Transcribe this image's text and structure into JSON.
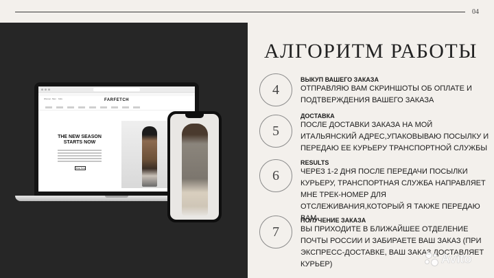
{
  "page_number": "04",
  "title": "АЛГОРИТМ РАБОТЫ",
  "mockup": {
    "site_logo": "FARFETCH",
    "nav_tabs": [
      "Women",
      "Men",
      "Kids"
    ],
    "hero_title": "THE NEW SEASON STARTS NOW",
    "hero_button": "Shop Now"
  },
  "steps": [
    {
      "number": "4",
      "title": "ВЫКУП ВАШЕГО ЗАКАЗА",
      "text": "ОТПРАВЛЯЮ ВАМ СКРИНШОТЫ ОБ ОПЛАТЕ И ПОДТВЕРЖДЕНИЯ  ВАШЕГО ЗАКАЗА"
    },
    {
      "number": "5",
      "title": "ДОСТАВКА",
      "text": "ПОСЛЕ ДОСТАВКИ ЗАКАЗА НА МОЙ ИТАЛЬЯНСКИЙ АДРЕС,УПАКОВЫВАЮ ПОСЫЛКУ И ПЕРЕДАЮ ЕЕ КУРЬЕРУ ТРАНСПОРТНОЙ СЛУЖБЫ"
    },
    {
      "number": "6",
      "title": "RESULTS",
      "text": "ЧЕРЕЗ 1-2 ДНЯ ПОСЛЕ ПЕРЕДАЧИ  ПОСЫЛКИ КУРЬЕРУ, ТРАНСПОРТНАЯ СЛУЖБА НАПРАВЛЯЕТ МНЕ ТРЕК-НОМЕР ДЛЯ ОТСЛЕЖИВАНИЯ,КОТОРЫЙ Я ТАКЖЕ ПЕРЕДАЮ ВАМ"
    },
    {
      "number": "7",
      "title": "ПОЛУЧЕНИЕ ЗАКАЗА",
      "text": "ВЫ ПРИХОДИТЕ В БЛИЖАЙШЕЕ ОТДЕЛЕНИЕ ПОЧТЫ РОССИИ И ЗАБИРАЕТЕ ВАШ ЗАКАЗ (ПРИ ЭКСПРЕСС-ДОСТАВКЕ, ВАШ ЗАКАЗ ДОСТАВЛЯЕТ КУРЬЕР)"
    }
  ],
  "watermark": "Avito",
  "colors": {
    "background": "#f3f0ec",
    "dark_panel": "#262626",
    "text": "#1a1a1a"
  }
}
